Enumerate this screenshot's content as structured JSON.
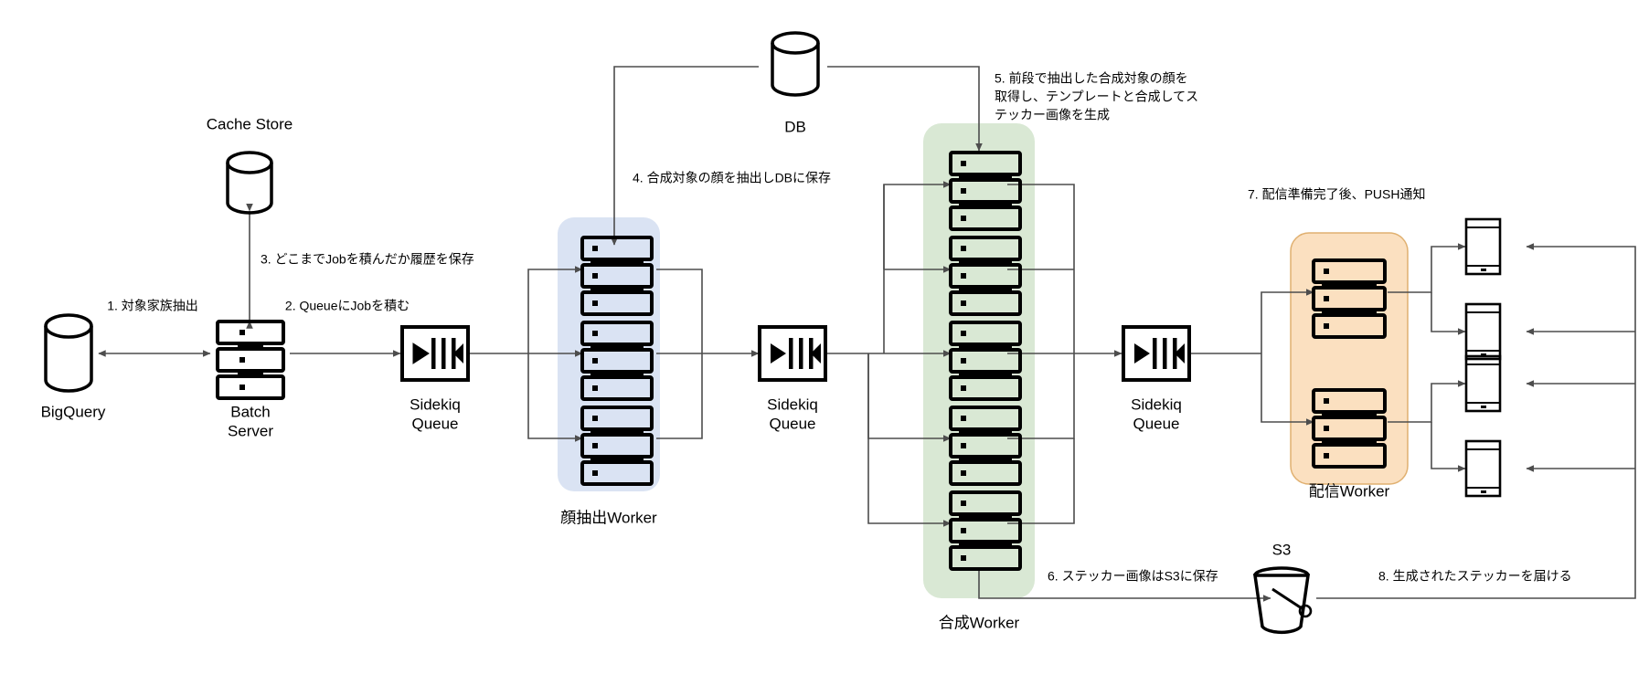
{
  "diagram": {
    "title": "Sticker generation pipeline architecture",
    "colors": {
      "face_worker_group": "#dae3f3",
      "compose_worker_group": "#d9e8d4",
      "delivery_worker_group": "#fbe0c0",
      "delivery_worker_group_border": "#e0b070",
      "line": "#4d4d4d",
      "shape": "#000000",
      "background": "#ffffff"
    },
    "nodes": {
      "bigquery": {
        "label": "BigQuery",
        "icon": "database-cylinder-icon"
      },
      "batch_server": {
        "label_line1": "Batch",
        "label_line2": "Server",
        "icon": "server-stack-icon"
      },
      "cache_store": {
        "label": "Cache Store",
        "icon": "database-cylinder-icon"
      },
      "db": {
        "label": "DB",
        "icon": "database-cylinder-icon"
      },
      "s3": {
        "label": "S3",
        "icon": "bucket-icon"
      },
      "queue1": {
        "label_line1": "Sidekiq",
        "label_line2": "Queue",
        "icon": "queue-icon"
      },
      "queue2": {
        "label_line1": "Sidekiq",
        "label_line2": "Queue",
        "icon": "queue-icon"
      },
      "queue3": {
        "label_line1": "Sidekiq",
        "label_line2": "Queue",
        "icon": "queue-icon"
      },
      "face_worker": {
        "label": "顔抽出Worker",
        "stack_count": 3
      },
      "compose_worker": {
        "label": "合成Worker",
        "stack_count": 5
      },
      "delivery_worker": {
        "label": "配信Worker",
        "stack_count": 2
      },
      "devices": {
        "icon": "smartphone-icon",
        "count": 4
      }
    },
    "annotations": [
      {
        "id": "step1",
        "text": "1. 対象家族抽出"
      },
      {
        "id": "step2",
        "text": "2. QueueにJobを積む"
      },
      {
        "id": "step3",
        "text": "3. どこまでJobを積んだか履歴を保存"
      },
      {
        "id": "step4",
        "text": "4. 合成対象の顔を抽出しDBに保存"
      },
      {
        "id": "step5",
        "line1": "5. 前段で抽出した合成対象の顔を",
        "line2": "取得し、テンプレートと合成してス",
        "line3": "テッカー画像を生成"
      },
      {
        "id": "step6",
        "text": "6. ステッカー画像はS3に保存"
      },
      {
        "id": "step7",
        "text": "7. 配信準備完了後、PUSH通知"
      },
      {
        "id": "step8",
        "text": "8. 生成されたステッカーを届ける"
      }
    ]
  }
}
